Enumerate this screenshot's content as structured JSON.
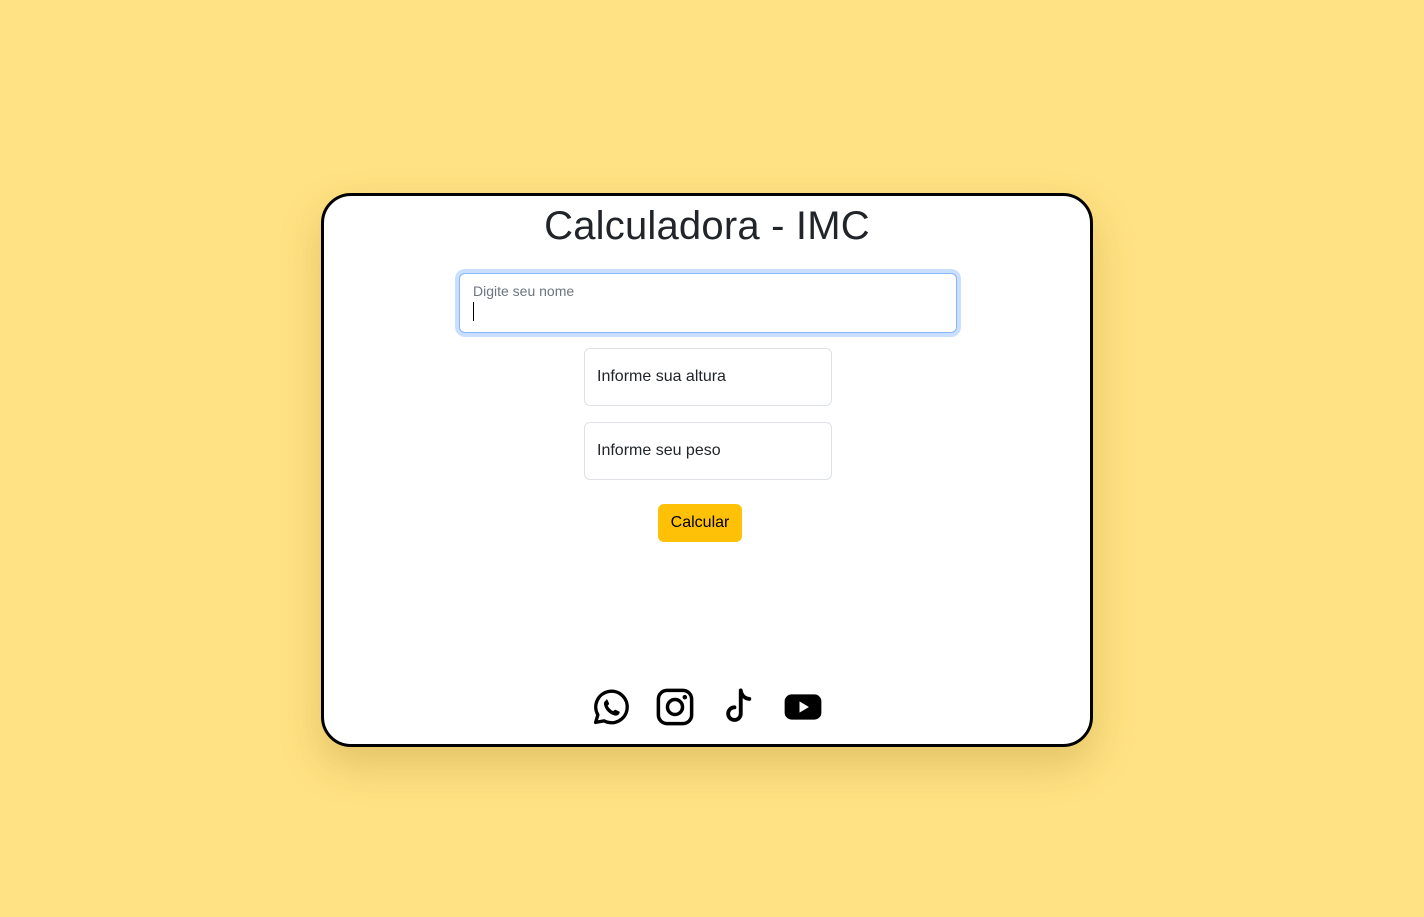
{
  "page": {
    "title": "Calculadora - IMC",
    "background_color": "#ffe283",
    "card_color": "#ffffff"
  },
  "form": {
    "name_label": "Digite seu nome",
    "name_value": "",
    "height_placeholder": "Informe sua altura",
    "weight_placeholder": "Informe seu peso",
    "submit_label": "Calcular",
    "submit_color": "#ffc107"
  },
  "social": [
    {
      "icon": "whatsapp-icon"
    },
    {
      "icon": "instagram-icon"
    },
    {
      "icon": "tiktok-icon"
    },
    {
      "icon": "youtube-icon"
    }
  ]
}
